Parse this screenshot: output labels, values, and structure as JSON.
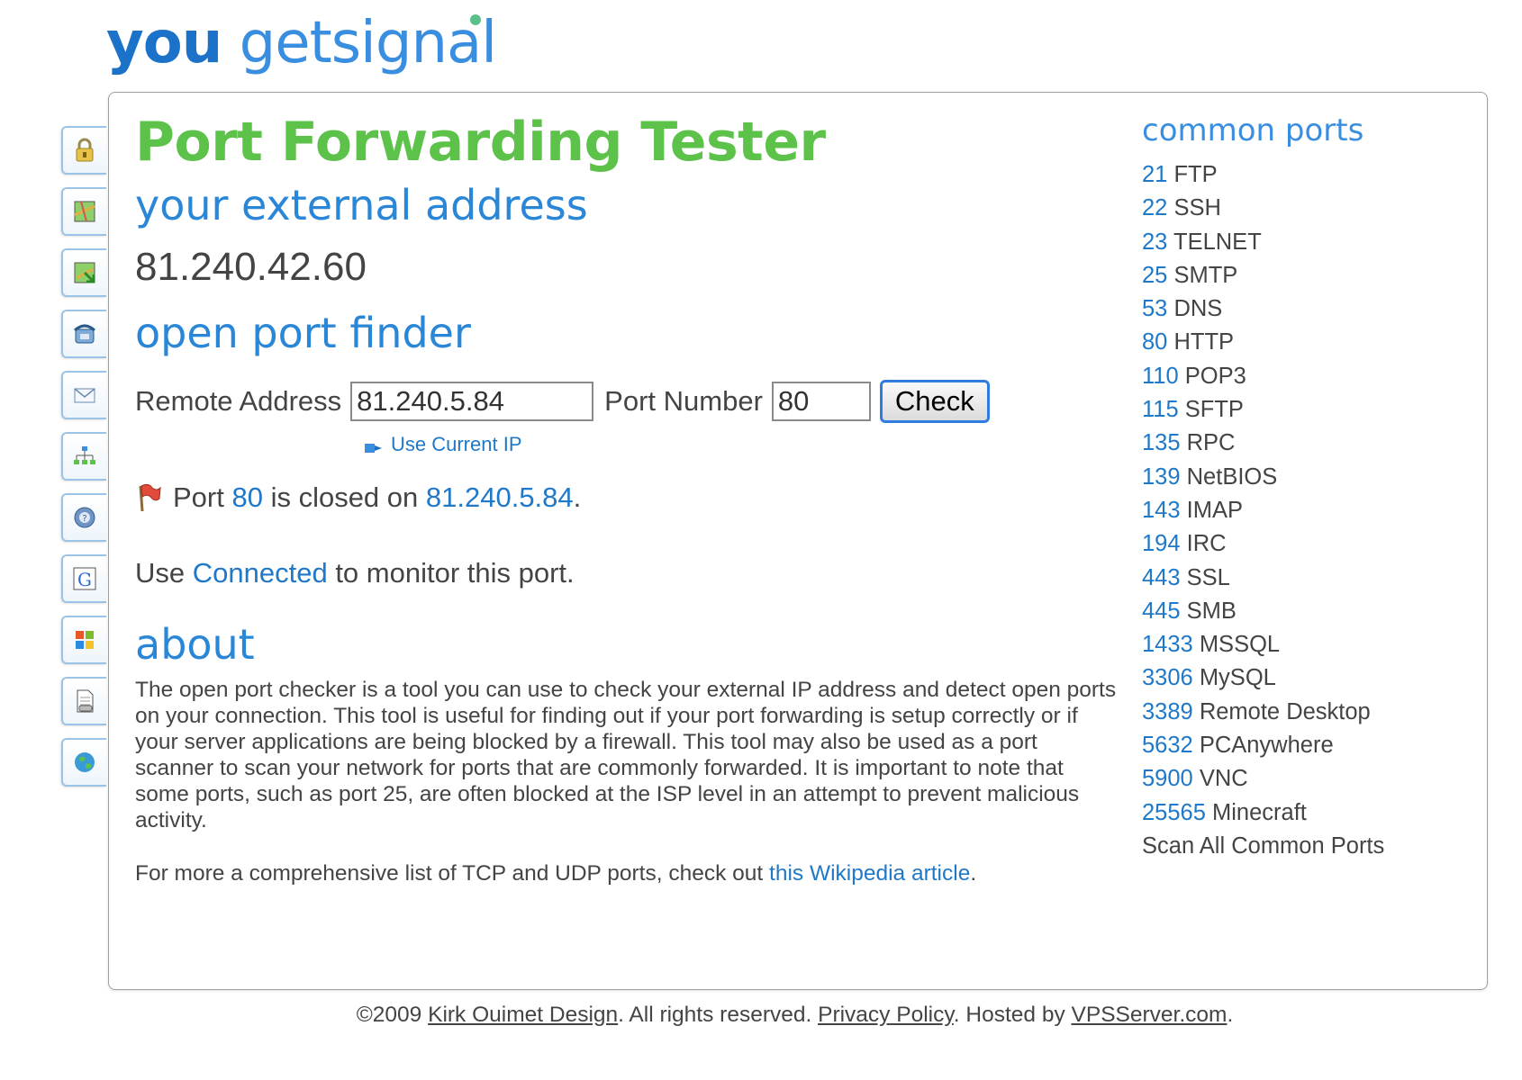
{
  "logo": {
    "word1": "you",
    "word2": "get",
    "word3": "signal"
  },
  "side_tabs": [
    {
      "icon": "lock-icon"
    },
    {
      "icon": "map-icon"
    },
    {
      "icon": "map-arrow-icon"
    },
    {
      "icon": "phone-icon"
    },
    {
      "icon": "mail-icon"
    },
    {
      "icon": "network-icon"
    },
    {
      "icon": "help-icon"
    },
    {
      "icon": "google-icon"
    },
    {
      "icon": "windows-icon"
    },
    {
      "icon": "document-icon"
    },
    {
      "icon": "globe-icon"
    }
  ],
  "main": {
    "title": "Port Forwarding Tester",
    "external_heading": "your external address",
    "external_ip": "81.240.42.60",
    "finder_heading": "open port finder",
    "form": {
      "remote_label": "Remote Address",
      "remote_value": "81.240.5.84",
      "port_label": "Port Number",
      "port_value": "80",
      "check_label": "Check",
      "use_current": "Use Current IP"
    },
    "result": {
      "prefix": "Port ",
      "port": "80",
      "middle": " is closed on ",
      "ip": "81.240.5.84",
      "suffix": "."
    },
    "monitor": {
      "prefix": "Use ",
      "link": "Connected",
      "suffix": " to monitor this port."
    },
    "about_heading": "about",
    "about_text": "The open port checker is a tool you can use to check your external IP address and detect open ports on your connection. This tool is useful for finding out if your port forwarding is setup correctly or if your server applications are being blocked by a firewall. This tool may also be used as a port scanner to scan your network for ports that are commonly forwarded. It is important to note that some ports, such as port 25, are often blocked at the ISP level in an attempt to prevent malicious activity.",
    "more_prefix": "For more a comprehensive list of TCP and UDP ports, check out ",
    "more_link": "this Wikipedia article",
    "more_suffix": "."
  },
  "ports": {
    "heading": "common ports",
    "items": [
      {
        "num": "21",
        "name": " FTP"
      },
      {
        "num": "22",
        "name": " SSH"
      },
      {
        "num": "23",
        "name": " TELNET"
      },
      {
        "num": "25",
        "name": " SMTP"
      },
      {
        "num": "53",
        "name": " DNS"
      },
      {
        "num": "80",
        "name": " HTTP"
      },
      {
        "num": "110",
        "name": " POP3"
      },
      {
        "num": "115",
        "name": " SFTP"
      },
      {
        "num": "135",
        "name": " RPC"
      },
      {
        "num": "139",
        "name": " NetBIOS"
      },
      {
        "num": "143",
        "name": " IMAP"
      },
      {
        "num": "194",
        "name": " IRC"
      },
      {
        "num": "443",
        "name": " SSL"
      },
      {
        "num": "445",
        "name": " SMB"
      },
      {
        "num": "1433",
        "name": " MSSQL"
      },
      {
        "num": "3306",
        "name": " MySQL"
      },
      {
        "num": "3389",
        "name": " Remote Desktop"
      },
      {
        "num": "5632",
        "name": " PCAnywhere"
      },
      {
        "num": "5900",
        "name": " VNC"
      },
      {
        "num": "25565",
        "name": " Minecraft"
      }
    ],
    "scan_all": "Scan All Common Ports"
  },
  "footer": {
    "copyright": "©2009 ",
    "kirk": "Kirk Ouimet Design",
    "rights": ". All rights reserved. ",
    "privacy": "Privacy Policy",
    "hosted": ". Hosted by ",
    "vps": "VPSServer.com",
    "end": "."
  },
  "colors": {
    "title_green": "#5cc24a",
    "heading_blue": "#2a86d6",
    "link_blue": "#1f78c8",
    "text_gray": "#444444",
    "button_border": "#2f7be0"
  }
}
